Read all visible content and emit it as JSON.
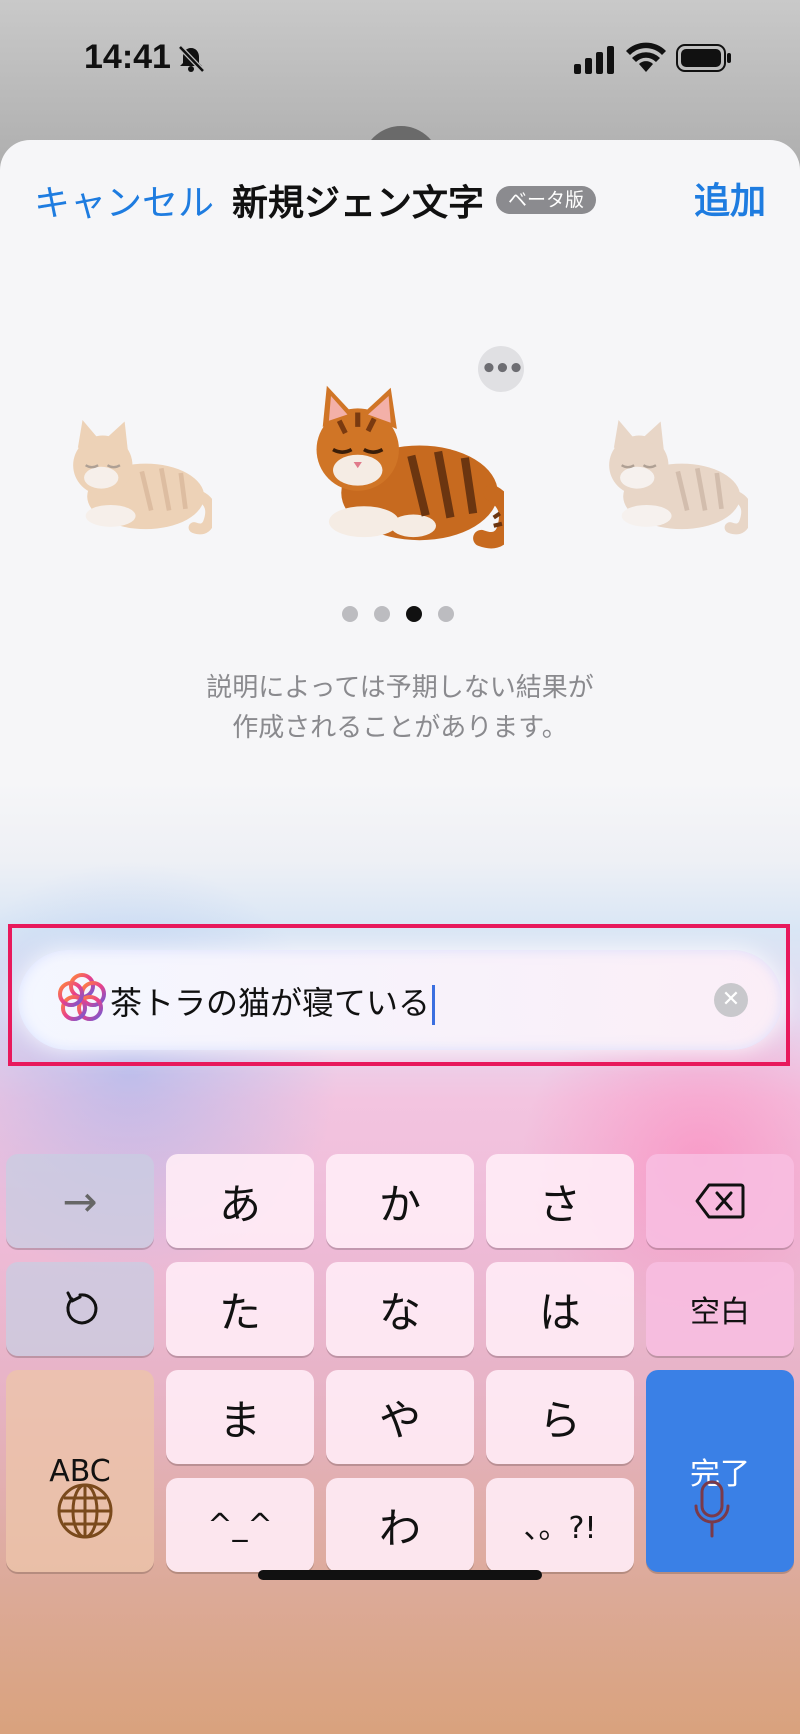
{
  "status_bar": {
    "time": "14:41"
  },
  "nav": {
    "cancel_label": "キャンセル",
    "title": "新規ジェン文字",
    "badge": "ベータ版",
    "add_label": "追加"
  },
  "carousel": {
    "page_count": 4,
    "active_index": 2
  },
  "disclaimer": {
    "line1": "説明によっては予期しない結果が",
    "line2": "作成されることがあります。"
  },
  "input": {
    "value": "茶トラの猫が寝ている"
  },
  "keyboard": {
    "row1": [
      "→",
      "あ",
      "か",
      "さ",
      "delete"
    ],
    "row2": [
      "undo",
      "た",
      "な",
      "は",
      "空白"
    ],
    "row3": [
      "ABC",
      "ま",
      "や",
      "ら",
      "完了"
    ],
    "row4": [
      "^_^",
      "わ",
      "、。?!"
    ],
    "next_label": "→",
    "a": "あ",
    "ka": "か",
    "sa": "さ",
    "ta": "た",
    "na": "な",
    "ha": "は",
    "space": "空白",
    "abc": "ABC",
    "ma": "ま",
    "ya": "や",
    "ra": "ら",
    "done": "完了",
    "emoticon": "^_^",
    "wa": "わ",
    "punct": "、。?!"
  },
  "colors": {
    "accent": "#1e7ce0",
    "highlight": "#e8195c",
    "done_key": "#3a80e6"
  }
}
